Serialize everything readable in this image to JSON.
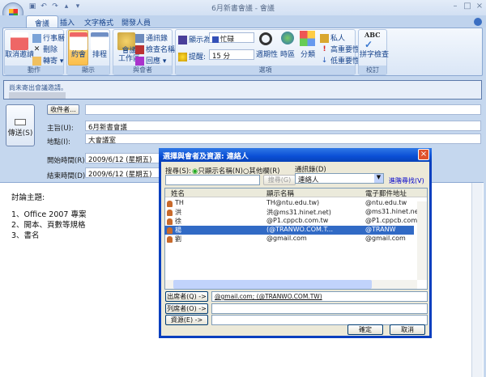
{
  "window": {
    "title": "6月新書會議 - 會議",
    "minimize": "–",
    "maximize": "□",
    "close": "×"
  },
  "qat": [
    "save",
    "undo",
    "redo",
    "up",
    "down"
  ],
  "tabs": [
    {
      "label": "會議",
      "active": true
    },
    {
      "label": "插入"
    },
    {
      "label": "文字格式"
    },
    {
      "label": "開發人員"
    }
  ],
  "ribbon": {
    "actions": {
      "label": "動作",
      "cancel": "取消邀請",
      "calendar": "行事曆",
      "delete": "刪除",
      "forward": "轉寄 ▾"
    },
    "show": {
      "label": "顯示",
      "appointment": "約會",
      "schedule": "排程"
    },
    "attendees": {
      "label": "與會者",
      "workspace1": "會議",
      "workspace2": "工作區",
      "address_book": "通訊錄",
      "check_names": "檢查名稱",
      "response": "回應 ▾"
    },
    "options": {
      "label": "選項",
      "show_as_label": "顯示為:",
      "show_as_value": "忙碌",
      "reminder_label": "提醒:",
      "reminder_value": "15 分",
      "recurrence": "週期性",
      "timezone": "時區",
      "categorize": "分類",
      "private": "私人",
      "high": "高重要性",
      "low": "低重要性"
    },
    "proofing": {
      "label": "校訂",
      "spelling": "拼字檢查"
    }
  },
  "infobar": {
    "text": "尚未寄出會議邀請。"
  },
  "form": {
    "send": "傳送(S)",
    "to_button": "收件者...",
    "to_value": "",
    "subject_label": "主旨(U):",
    "subject": "6月新書會議",
    "location_label": "地點(I):",
    "location": "大會議室",
    "start_label": "開始時間(R):",
    "start": "2009/6/12 (星期五)",
    "end_label": "結束時間(D):",
    "end": "2009/6/12 (星期五)"
  },
  "body": {
    "lines": [
      "討論主題:",
      "",
      "1、Office 2007 專案",
      "2、開本、頁數等規格",
      "3、書名"
    ]
  },
  "dialog": {
    "title": "選擇與會者及資源: 連絡人",
    "search_label": "搜尋(S):",
    "radio_name": "只顯示名稱(N)",
    "radio_other": "其他欄(R)",
    "search_value": "",
    "search_button": "搜尋(G)",
    "addressbook_label": "通訊錄(D)",
    "addressbook_value": "連絡人",
    "advanced": "進階尋找(V)",
    "columns": [
      "姓名",
      "顯示名稱",
      "電子郵件地址"
    ],
    "rows": [
      {
        "name": "TH",
        "display": "TH@ntu.edu.tw)",
        "email": "@ntu.edu.tw"
      },
      {
        "name": "洪",
        "display": "洪@ms31.hinet.net)",
        "email": "@ms31.hinet.net"
      },
      {
        "name": "徐",
        "display": "@P1.cppcb.com.tw",
        "email": "@P1.cppcb.com.tw"
      },
      {
        "name": "楊",
        "display": "(@TRANWO.COM.T...",
        "email": "@TRANW",
        "selected": true
      },
      {
        "name": "劉",
        "display": "@gmail.com",
        "email": "@gmail.com"
      }
    ],
    "required_button": "出席者(Q) ->",
    "required_value": "@gmail.com; (@TRANWO.COM.TW)",
    "optional_button": "列席者(O) ->",
    "optional_value": "",
    "resources_button": "資源(E) ->",
    "resources_value": "",
    "ok": "確定",
    "cancel": "取消"
  }
}
